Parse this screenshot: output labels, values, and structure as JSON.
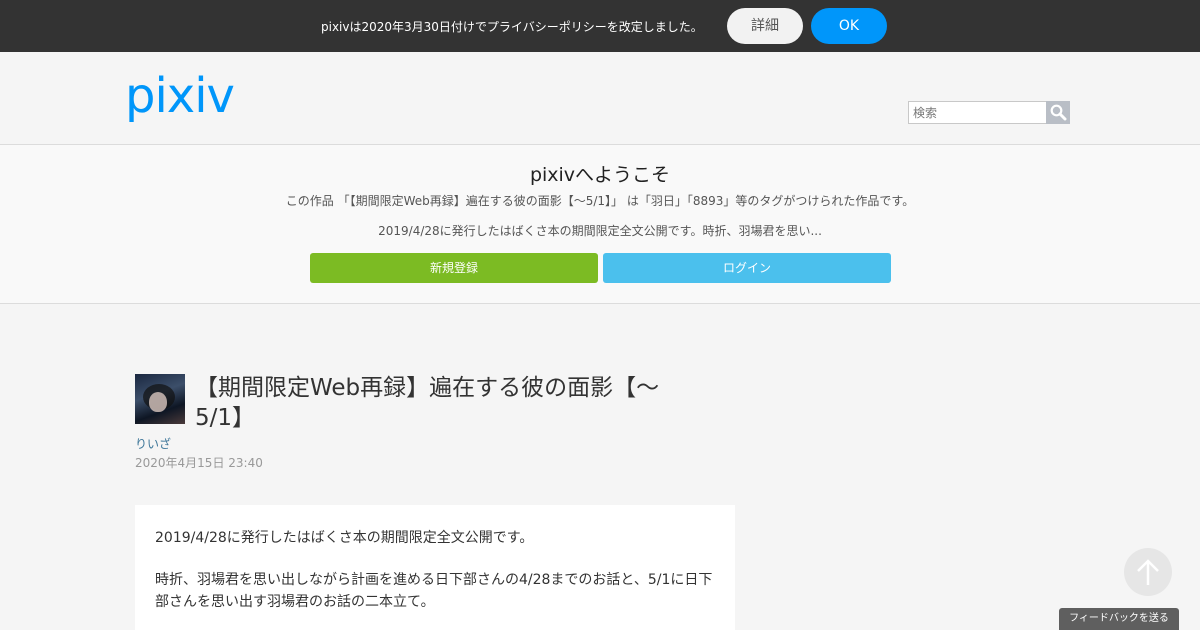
{
  "notice": {
    "text": "pixivは2020年3月30日付けでプライバシーポリシーを改定しました。",
    "details_label": "詳細",
    "ok_label": "OK"
  },
  "header": {
    "logo_text": "pixiv",
    "search_placeholder": "検索"
  },
  "welcome": {
    "title": "pixivへようこそ",
    "description": "この作品 「【期間限定Web再録】遍在する彼の面影【～5/1】」 は「羽日」「8893」等のタグがつけられた作品です。",
    "caption_excerpt": "2019/4/28に発行したはばくさ本の期間限定全文公開です。時折、羽場君を思い...",
    "signup_label": "新規登録",
    "login_label": "ログイン"
  },
  "work": {
    "title": "【期間限定Web再録】遍在する彼の面影【～5/1】",
    "author": "りいざ",
    "date": "2020年4月15日 23:40",
    "caption_p1": "2019/4/28に発行したはばくさ本の期間限定全文公開です。",
    "caption_p2": "時折、羽場君を思い出しながら計画を進める日下部さんの4/28までのお話と、5/1に日下部さんを思い出す羽場君のお話の二本立て。"
  },
  "footer": {
    "feedback_label": "フィードバックを送る"
  },
  "colors": {
    "brand": "#0096fa",
    "signup": "#7cbb23",
    "login": "#4bc0ed",
    "notice_bg": "#333333"
  }
}
